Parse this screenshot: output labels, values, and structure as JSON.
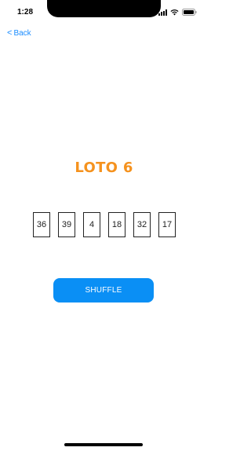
{
  "status_bar": {
    "time": "1:28"
  },
  "nav": {
    "back_label": "Back",
    "back_chevron": "<"
  },
  "title": "LOTO 6",
  "numbers": [
    "36",
    "39",
    "4",
    "18",
    "32",
    "17"
  ],
  "shuffle_label": "SHUFFLE",
  "colors": {
    "accent": "#0a8ff5",
    "title": "#f5921e",
    "link": "#1a8cff"
  },
  "icons": [
    "signal-icon",
    "wifi-icon",
    "battery-icon",
    "chevron-left-icon"
  ]
}
